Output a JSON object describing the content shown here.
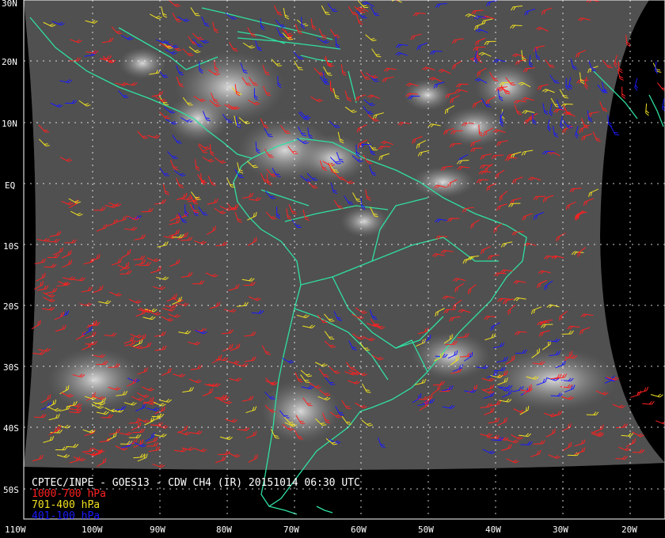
{
  "title": "CPTEC/INPE - GOES13 - CDW CH4 (IR) 20151014 06:30 UTC",
  "legend": [
    {
      "label": "1000-700 hPa",
      "color": "#ff2020"
    },
    {
      "label": "701-400 hPa",
      "color": "#f0e020"
    },
    {
      "label": "401-100 hPa",
      "color": "#1a1aff"
    }
  ],
  "lat_labels": [
    "30N",
    "20N",
    "10N",
    "EQ",
    "10S",
    "20S",
    "30S",
    "40S",
    "50S"
  ],
  "lon_labels": [
    "110W",
    "100W",
    "90W",
    "80W",
    "70W",
    "60W",
    "50W",
    "40W",
    "30W",
    "20W"
  ],
  "colors": {
    "coast": "#30e0a0",
    "grid": "#ffffff",
    "background": "#000000"
  }
}
